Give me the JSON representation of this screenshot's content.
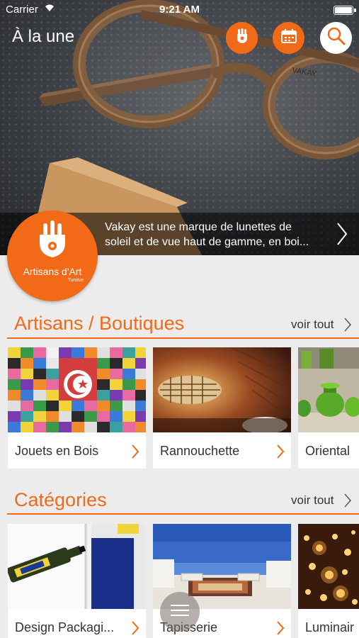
{
  "status_bar": {
    "carrier": "Carrier",
    "time": "9:21 AM"
  },
  "header": {
    "title": "À la une"
  },
  "top_buttons": [
    {
      "name": "artisan-button",
      "icon": "hand-icon",
      "color": "#f26a18"
    },
    {
      "name": "calendar-button",
      "icon": "calendar-icon",
      "color": "#f26a18"
    },
    {
      "name": "search-button",
      "icon": "search-icon",
      "color": "#ffffff"
    }
  ],
  "featured": {
    "caption_line1": "Vakay est une marque de lunettes de",
    "caption_line2": "soleil et de vue haut de gamme, en boi..."
  },
  "logo": {
    "name": "Artisans d'Art",
    "subtitle": "Tunisie"
  },
  "sections": {
    "artisans": {
      "title": "Artisans / Boutiques",
      "see_all": "voir tout",
      "cards": [
        {
          "label": "Jouets en Bois"
        },
        {
          "label": "Rannouchette"
        },
        {
          "label": "Oriental"
        }
      ]
    },
    "categories": {
      "title": "Catégories",
      "see_all": "voir tout",
      "cards": [
        {
          "label": "Design Packagi..."
        },
        {
          "label": "Tapisserie"
        },
        {
          "label": "Luminair"
        }
      ]
    }
  },
  "colors": {
    "accent": "#f26a18",
    "background": "#ececec"
  }
}
